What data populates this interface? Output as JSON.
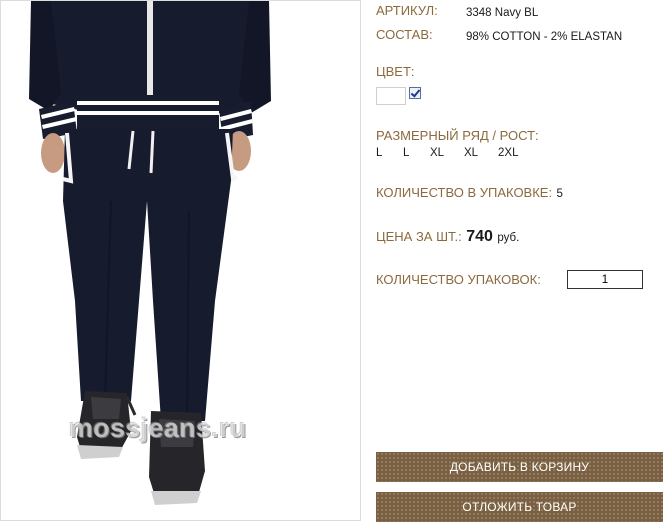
{
  "product": {
    "article_label": "АРТИКУЛ:",
    "article_value": "3348 Navy BL",
    "composition_label": "СОСТАВ:",
    "composition_value": "98% COTTON - 2% ELASTAN",
    "color_label": "ЦВЕТ:",
    "size_label": "РАЗМЕРНЫЙ РЯД / РОСТ:",
    "sizes": [
      "L",
      "L",
      "XL",
      "XL",
      "2XL"
    ],
    "pack_qty_label": "КОЛИЧЕСТВО В УПАКОВКЕ:",
    "pack_qty_value": "5",
    "price_label": "ЦЕНА ЗА ШТ.:",
    "price_value": "740",
    "price_currency": "руб.",
    "packs_label": "КОЛИЧЕСТВО УПАКОВОК:",
    "packs_value": "1"
  },
  "photo": {
    "watermark": "mossjeans.ru"
  },
  "actions": {
    "add_to_cart": "ДОБАВИТЬ В КОРЗИНУ",
    "defer": "ОТЛОЖИТЬ ТОВАР"
  },
  "colors": {
    "label": "#8b6a3e",
    "button": "#7a6040",
    "garment": "#161b2e"
  }
}
